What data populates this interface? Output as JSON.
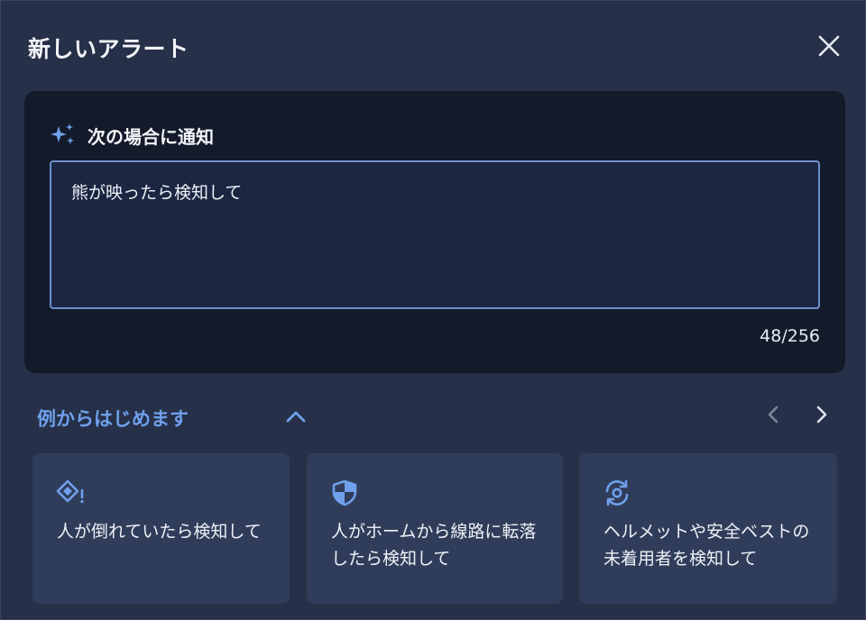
{
  "dialog": {
    "title": "新しいアラート",
    "close_icon": "close-icon"
  },
  "notify": {
    "label": "次の場合に通知",
    "label_icon": "sparkle-icon",
    "prompt_value": "熊が映ったら検知して",
    "char_count": "48/256"
  },
  "examples": {
    "heading": "例からはじめます",
    "collapse_icon": "chevron-up-icon",
    "prev_icon": "chevron-left-icon",
    "next_icon": "chevron-right-icon",
    "cards": [
      {
        "icon": "warning-diamond-icon",
        "text": "人が倒れていたら検知して"
      },
      {
        "icon": "shield-icon",
        "text": "人がホームから線路に転落したら検知して"
      },
      {
        "icon": "refresh-gear-icon",
        "text": "ヘルメットや安全ベストの未着用者を検知して"
      }
    ]
  },
  "colors": {
    "background": "#263048",
    "panel": "#131a2a",
    "accent": "#6fa0ec",
    "card": "#303d5a",
    "input_border": "#6d8fc9"
  }
}
